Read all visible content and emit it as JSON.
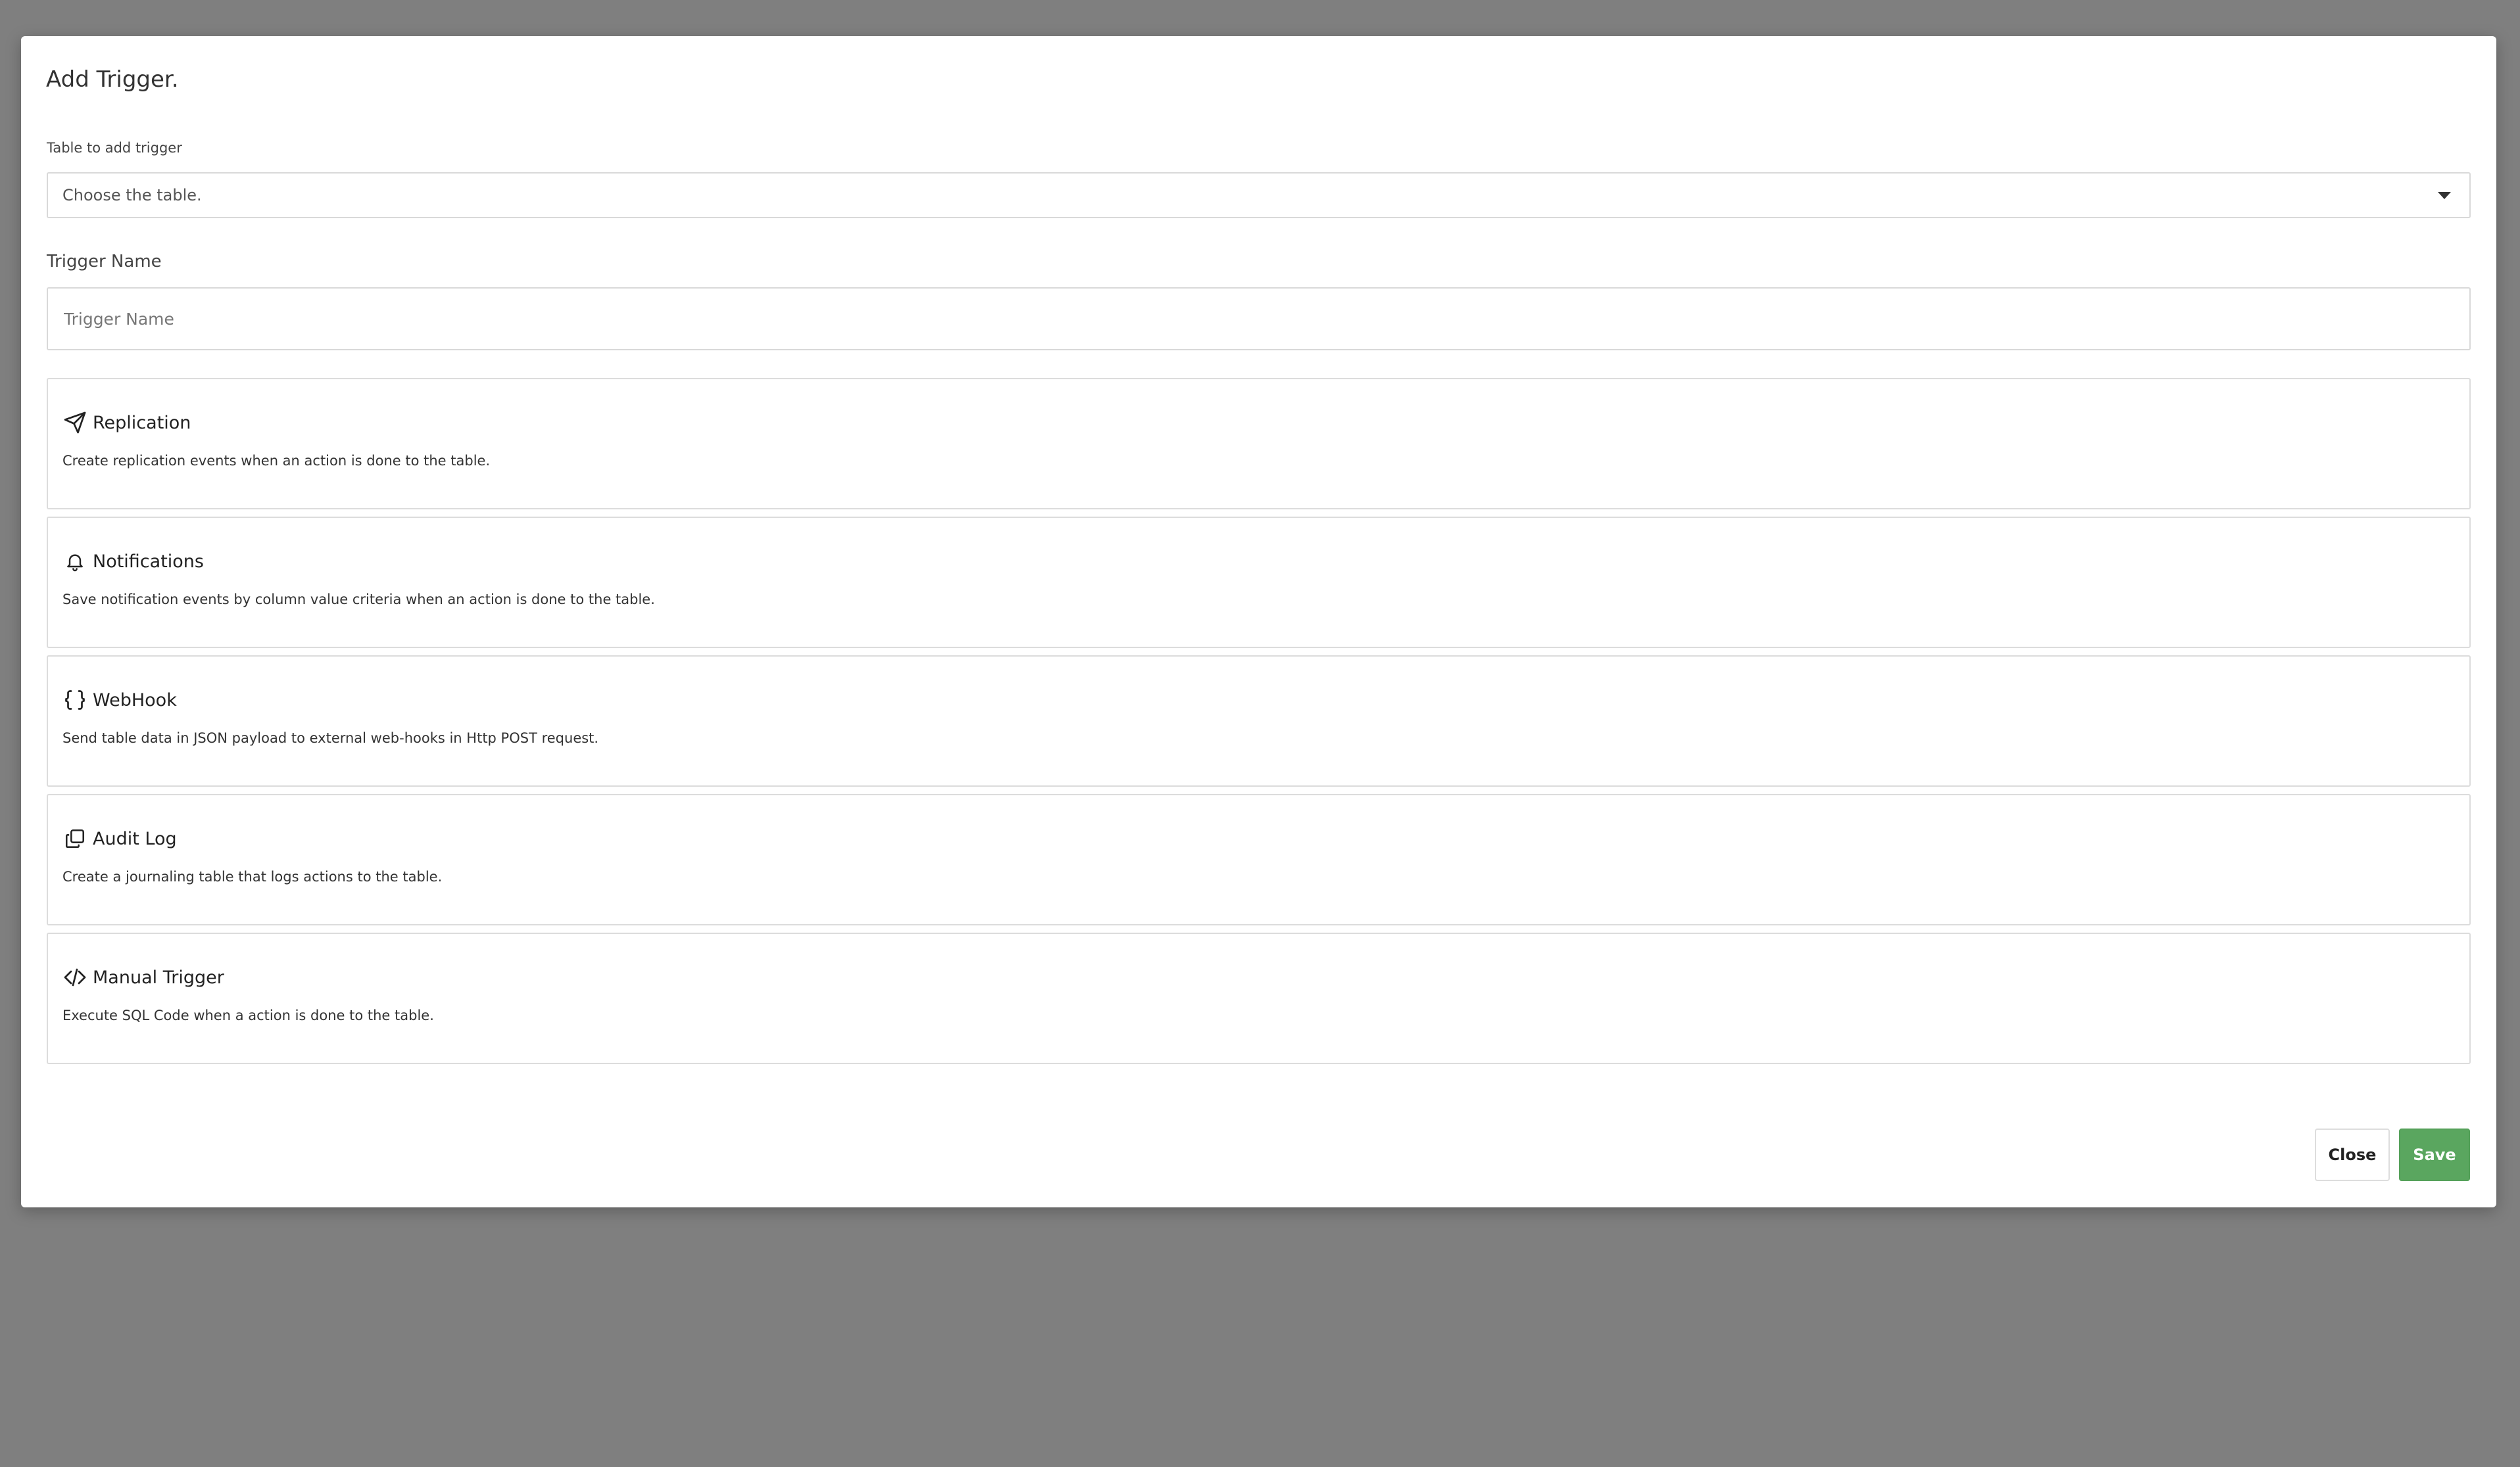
{
  "modal": {
    "title": "Add Trigger."
  },
  "table_field": {
    "label": "Table to add trigger",
    "value": "Choose the table."
  },
  "trigger_name": {
    "label": "Trigger Name",
    "placeholder": "Trigger Name",
    "value": ""
  },
  "options": [
    {
      "icon": "paper-plane-icon",
      "title": "Replication",
      "description": "Create replication events when an action is done to the table."
    },
    {
      "icon": "bell-icon",
      "title": "Notifications",
      "description": "Save notification events by column value criteria when an action is done to the table."
    },
    {
      "icon": "braces-icon",
      "title": "WebHook",
      "description": "Send table data in JSON payload to external web-hooks in Http POST request."
    },
    {
      "icon": "copy-icon",
      "title": "Audit Log",
      "description": "Create a journaling table that logs actions to the table."
    },
    {
      "icon": "code-icon",
      "title": "Manual Trigger",
      "description": "Execute SQL Code when a action is done to the table."
    }
  ],
  "footer": {
    "close_label": "Close",
    "save_label": "Save"
  },
  "colors": {
    "save_button": "#5aa65f",
    "backdrop": "#7f7f7f"
  }
}
